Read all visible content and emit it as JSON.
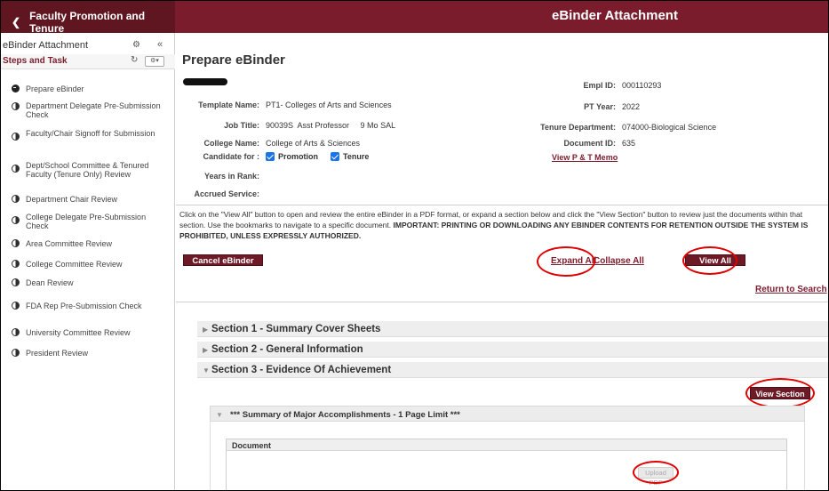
{
  "header": {
    "back_label": "Faculty Promotion and Tenure",
    "title": "eBinder Attachment",
    "colors": {
      "primary": "#7b1c2c",
      "dark": "#5f1620"
    }
  },
  "left_panel": {
    "title": "eBinder Attachment",
    "subtitle": "Steps and Task",
    "steps": [
      {
        "label": "Prepare eBinder",
        "status": "current"
      },
      {
        "label": "Department Delegate Pre-Submission Check",
        "status": "pending"
      },
      {
        "label": "Faculty/Chair Signoff for Submission",
        "status": "pending"
      },
      {
        "label": "Dept/School Committee & Tenured Faculty (Tenure Only) Review",
        "status": "pending"
      },
      {
        "label": "Department Chair Review",
        "status": "pending"
      },
      {
        "label": "College Delegate Pre-Submission Check",
        "status": "pending"
      },
      {
        "label": "Area Committee Review",
        "status": "pending"
      },
      {
        "label": "College Committee Review",
        "status": "pending"
      },
      {
        "label": "Dean Review",
        "status": "pending"
      },
      {
        "label": "FDA Rep Pre-Submission Check",
        "status": "pending"
      },
      {
        "label": "University Committee Review",
        "status": "pending"
      },
      {
        "label": "President Review",
        "status": "pending"
      }
    ]
  },
  "main": {
    "page_title": "Prepare eBinder",
    "fields": {
      "template_name_label": "Template Name:",
      "template_name": "PT1- Colleges of Arts and Sciences",
      "job_title_label": "Job Title:",
      "job_title": "90039S  Asst Professor     9 Mo SAL",
      "college_name_label": "College Name:",
      "college_name": "College of Arts & Sciences",
      "candidate_for_label": "Candidate for :",
      "candidate_promotion": "Promotion",
      "candidate_tenure": "Tenure",
      "years_in_rank_label": "Years in Rank:",
      "accrued_service_label": "Accrued Service:",
      "empl_id_label": "Empl ID:",
      "empl_id": "000110293",
      "pt_year_label": "PT Year:",
      "pt_year": "2022",
      "tenure_dept_label": "Tenure Department:",
      "tenure_dept": "074000-Biological Science",
      "document_id_label": "Document ID:",
      "document_id": "635",
      "view_memo": "View P & T Memo"
    },
    "notice_plain": "Click on the \"View All\" button to open and review the entire eBinder in a PDF format, or expand a section below and click the \"View Section\" button to review just the documents within that section. Use the bookmarks to navigate to a specific document. ",
    "notice_bold": "IMPORTANT: PRINTING OR DOWNLOADING ANY EBINDER CONTENTS FOR RETENTION OUTSIDE THE SYSTEM IS PROHIBITED, UNLESS EXPRESSLY AUTHORIZED.",
    "cancel_button": "Cancel eBinder",
    "expand_all": "Expand All",
    "collapse_all": "Collapse All",
    "view_all": "View All",
    "return_to_search": "Return to Search",
    "sections": [
      {
        "title": "Section 1 - Summary Cover Sheets",
        "expanded": false
      },
      {
        "title": "Section 2 - General Information",
        "expanded": false
      },
      {
        "title": "Section 3 - Evidence Of Achievement",
        "expanded": true
      }
    ],
    "view_section": "View Section",
    "subsection_title": "*** Summary of Major Accomplishments - 1 Page Limit ***",
    "document_header": "Document",
    "upload_pdf": "Upload PDF"
  }
}
